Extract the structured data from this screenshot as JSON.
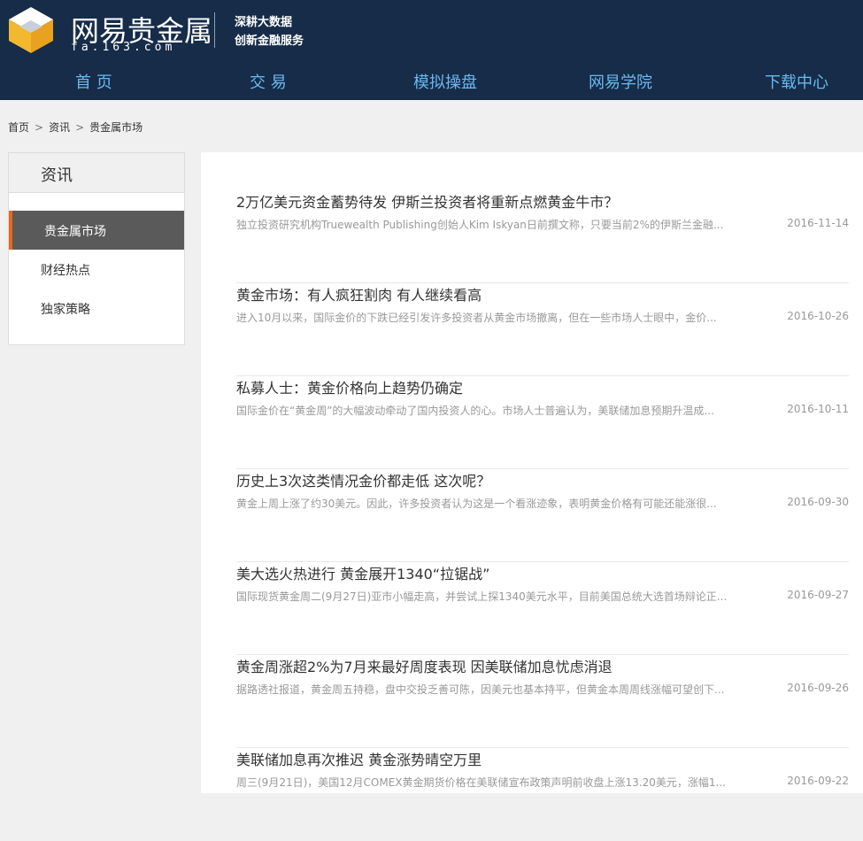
{
  "header": {
    "logo_title": "网易贵金属",
    "logo_sub": "fa.163.com",
    "slogan_line1": "深耕大数据",
    "slogan_line2": "创新金融服务",
    "colors": {
      "bg": "#162c49",
      "nav_text": "#6ab9ee"
    }
  },
  "nav": {
    "items": [
      "首 页",
      "交 易",
      "模拟操盘",
      "网易学院",
      "下载中心"
    ]
  },
  "breadcrumb": {
    "items": [
      "首页",
      "资讯",
      "贵金属市场"
    ],
    "separator": ">"
  },
  "sidebar": {
    "heading": "资讯",
    "items": [
      "贵金属市场",
      "财经热点",
      "独家策略"
    ],
    "active_index": 0,
    "accent": "#e8671c"
  },
  "articles": [
    {
      "title": "2万亿美元资金蓄势待发 伊斯兰投资者将重新点燃黄金牛市？",
      "summary": "独立投资研究机构Truewealth Publishing创始人Kim Iskyan日前撰文称，只要当前2%的伊斯兰金融...",
      "date": "2016-11-14"
    },
    {
      "title": "黄金市场：有人疯狂割肉 有人继续看高",
      "summary": "进入10月以来，国际金价的下跌已经引发许多投资者从黄金市场撤离，但在一些市场人士眼中，金价...",
      "date": "2016-10-26"
    },
    {
      "title": "私募人士：黄金价格向上趋势仍确定",
      "summary": "国际金价在“黄金周”的大幅波动牵动了国内投资人的心。市场人士普遍认为，美联储加息预期升温成...",
      "date": "2016-10-11"
    },
    {
      "title": "历史上3次这类情况金价都走低 这次呢？",
      "summary": "黄金上周上涨了约30美元。因此，许多投资者认为这是一个看涨迹象，表明黄金价格有可能还能涨很...",
      "date": "2016-09-30"
    },
    {
      "title": "美大选火热进行 黄金展开1340“拉锯战”",
      "summary": "国际现货黄金周二(9月27日)亚市小幅走高，并尝试上探1340美元水平，目前美国总统大选首场辩论正...",
      "date": "2016-09-27"
    },
    {
      "title": "黄金周涨超2%为7月来最好周度表现 因美联储加息忧虑消退",
      "summary": "据路透社报道，黄金周五持稳，盘中交投乏善可陈，因美元也基本持平，但黄金本周周线涨幅可望创下...",
      "date": "2016-09-26"
    },
    {
      "title": "美联储加息再次推迟 黄金涨势晴空万里",
      "summary": "周三(9月21日)，美国12月COMEX黄金期货价格在美联储宣布政策声明前收盘上涨13.20美元，涨幅1...",
      "date": "2016-09-22"
    }
  ]
}
